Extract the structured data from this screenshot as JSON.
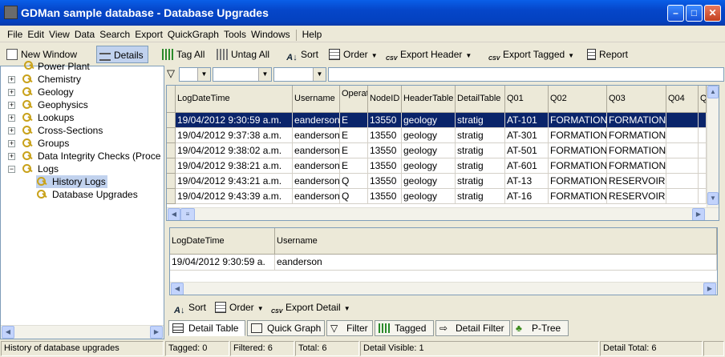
{
  "window": {
    "title": "GDMan sample database - Database Upgrades"
  },
  "menu": [
    "File",
    "Edit",
    "View",
    "Data",
    "Search",
    "Export",
    "QuickGraph",
    "Tools",
    "Windows",
    "Help"
  ],
  "toolbar": {
    "new_window": "New Window",
    "details": "Details",
    "tag_all": "Tag All",
    "untag_all": "Untag All",
    "sort": "Sort",
    "order": "Order",
    "export_header": "Export Header",
    "export_tagged": "Export Tagged",
    "report": "Report"
  },
  "tree": {
    "partial_top": "Power Plant",
    "items": [
      "Chemistry",
      "Geology",
      "Geophysics",
      "Lookups",
      "Cross-Sections",
      "Groups",
      "Data Integrity Checks (Proce",
      "Logs"
    ],
    "children": [
      "History Logs",
      "Database Upgrades"
    ]
  },
  "header_grid": {
    "columns": [
      "LogDateTime",
      "Username",
      "Operation",
      "NodeID",
      "HeaderTable",
      "DetailTable",
      "Q01",
      "Q02",
      "Q03",
      "Q04",
      "Q"
    ],
    "rows": [
      [
        "19/04/2012 9:30:59 a.m.",
        "eanderson",
        "E",
        "13550",
        "geology",
        "stratig",
        "AT-101",
        "FORMATION",
        "FORMATION",
        "",
        ""
      ],
      [
        "19/04/2012 9:37:38 a.m.",
        "eanderson",
        "E",
        "13550",
        "geology",
        "stratig",
        "AT-301",
        "FORMATION",
        "FORMATION",
        "",
        ""
      ],
      [
        "19/04/2012 9:38:02 a.m.",
        "eanderson",
        "E",
        "13550",
        "geology",
        "stratig",
        "AT-501",
        "FORMATION",
        "FORMATION",
        "",
        ""
      ],
      [
        "19/04/2012 9:38:21 a.m.",
        "eanderson",
        "E",
        "13550",
        "geology",
        "stratig",
        "AT-601",
        "FORMATION",
        "FORMATION",
        "",
        ""
      ],
      [
        "19/04/2012 9:43:21 a.m.",
        "eanderson",
        "Q",
        "13550",
        "geology",
        "stratig",
        "AT-13",
        "FORMATION",
        "RESERVOIR",
        "",
        ""
      ],
      [
        "19/04/2012 9:43:39 a.m.",
        "eanderson",
        "Q",
        "13550",
        "geology",
        "stratig",
        "AT-16",
        "FORMATION",
        "RESERVOIR",
        "",
        ""
      ]
    ]
  },
  "detail_grid": {
    "columns": [
      "LogDateTime",
      "Username"
    ],
    "rows": [
      [
        "19/04/2012 9:30:59 a.",
        "eanderson"
      ]
    ]
  },
  "detail_toolbar": {
    "sort": "Sort",
    "order": "Order",
    "export_detail": "Export Detail"
  },
  "tabs": [
    "Detail Table",
    "Quick Graph",
    "Filter",
    "Tagged",
    "Detail Filter",
    "P-Tree"
  ],
  "status": {
    "description": "History of database upgrades",
    "tagged": "Tagged: 0",
    "filtered": "Filtered: 6",
    "total": "Total: 6",
    "detail_visible": "Detail Visible: 1",
    "detail_total": "Detail Total: 6"
  },
  "colors": {
    "title_bar": "#0546c9",
    "selection": "#0a246a",
    "chrome": "#ece9d8"
  }
}
